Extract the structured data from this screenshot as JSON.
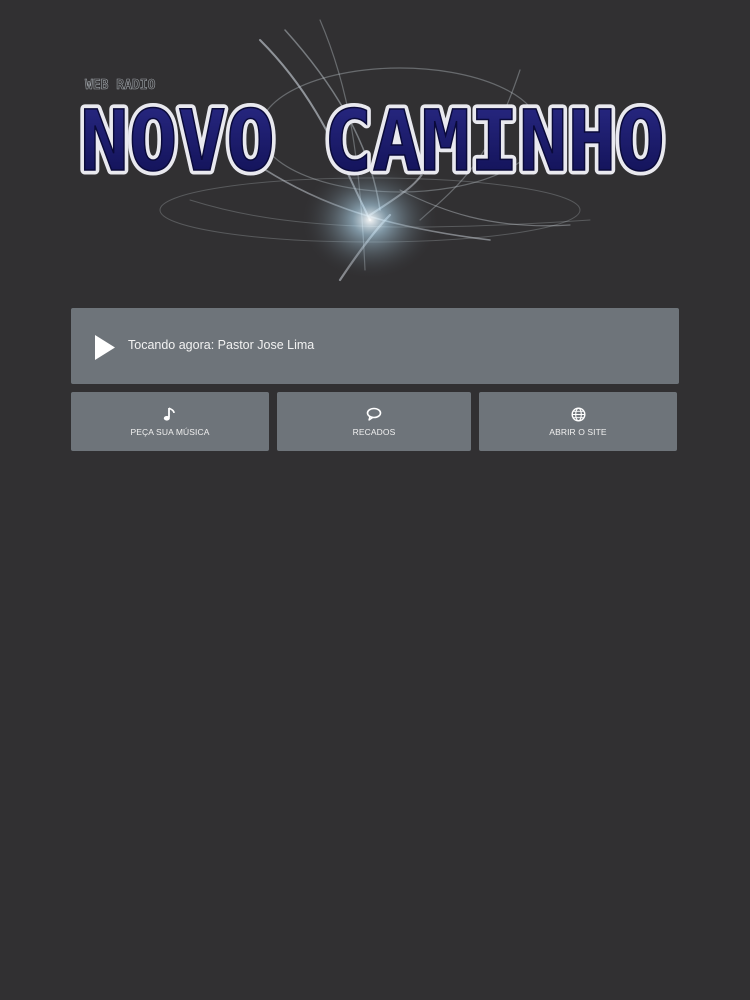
{
  "logo": {
    "small_text": "WEB RADIO",
    "title": "NOVO CAMINHO"
  },
  "player": {
    "now_playing": "Tocando agora: Pastor Jose Lima",
    "play_icon": "play-icon"
  },
  "actions": [
    {
      "label": "PEÇA SUA MÚSICA",
      "icon": "music-note-icon"
    },
    {
      "label": "RECADOS",
      "icon": "speech-bubble-icon"
    },
    {
      "label": "ABRIR O SITE",
      "icon": "globe-icon"
    }
  ],
  "colors": {
    "background": "#313032",
    "panel": "#6e747a",
    "logo_fill": "#1a1a6e",
    "logo_outline": "#e8e8ee"
  }
}
